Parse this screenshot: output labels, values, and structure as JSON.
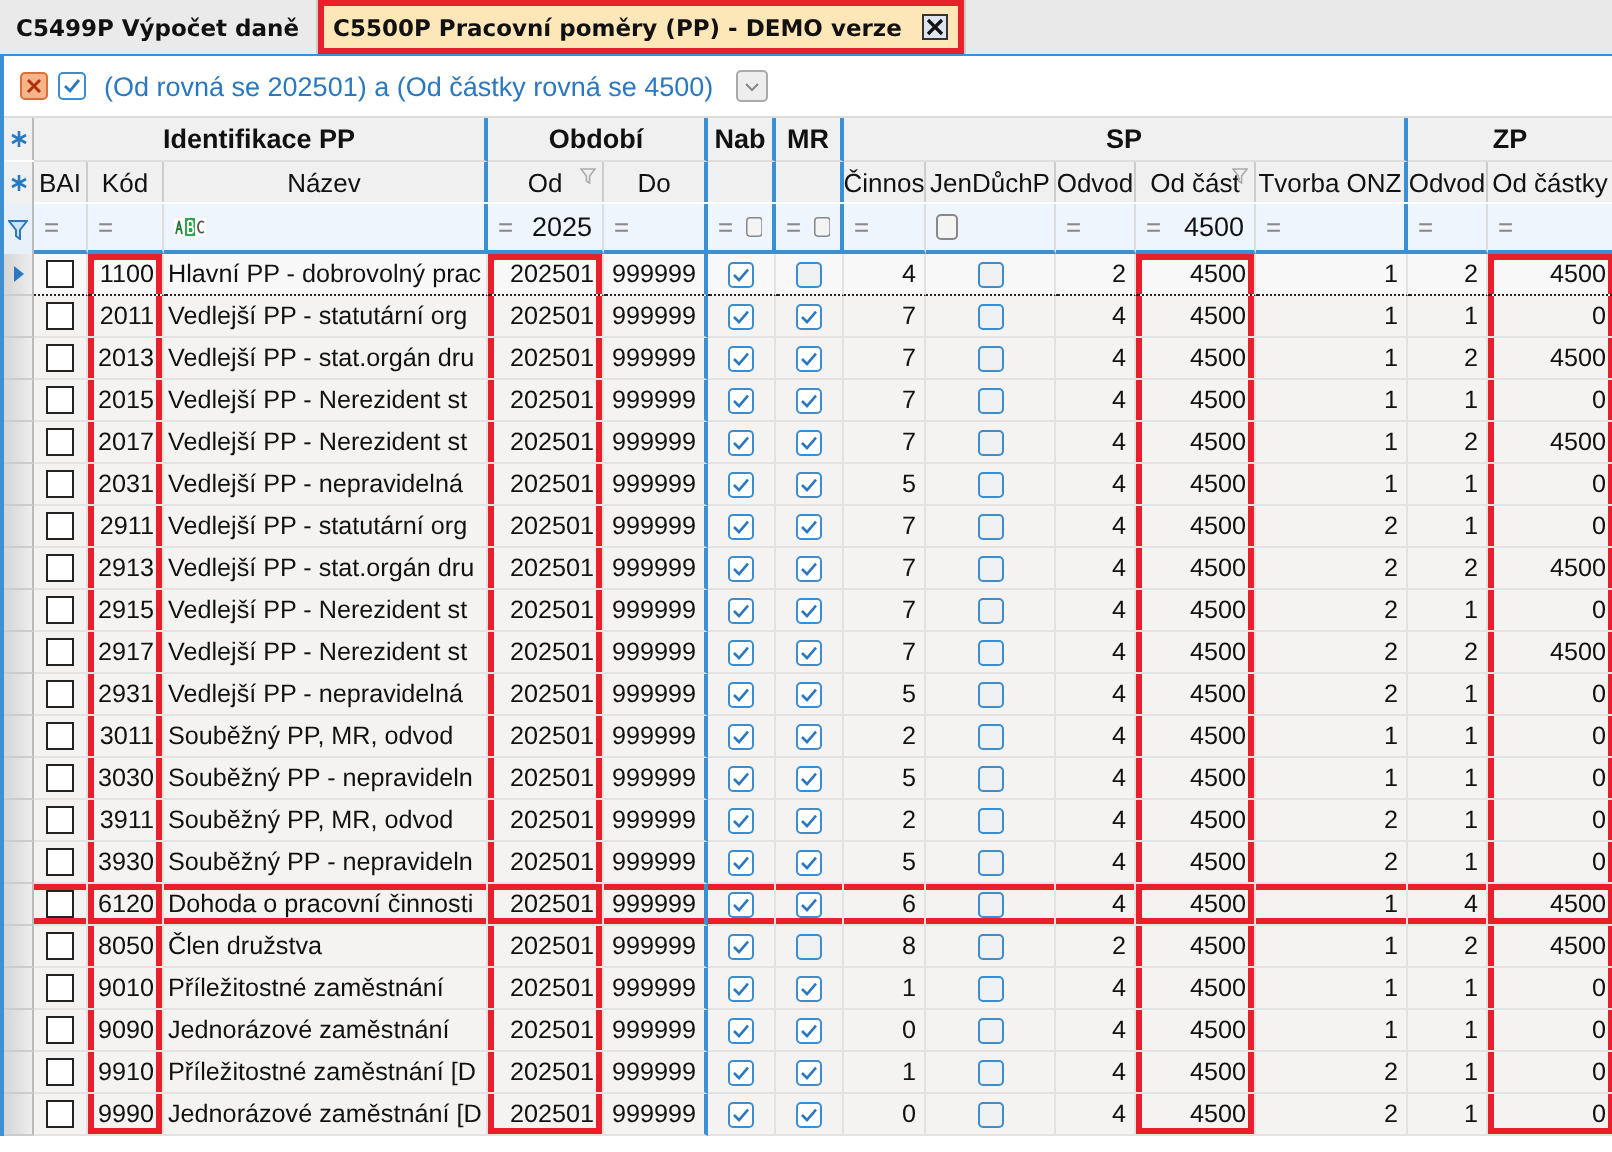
{
  "tabs": [
    {
      "label": "C5499P Výpočet daně",
      "selected": false,
      "closable": false,
      "highlighted": false
    },
    {
      "label": "C5500P Pracovní poměry (PP) - DEMO verze",
      "selected": true,
      "closable": true,
      "highlighted": true
    }
  ],
  "filter_bar": {
    "enabled": true,
    "text": "(Od rovná se 202501) a  (Od částky rovná se 4500)"
  },
  "groups": [
    {
      "label": "Identifikace PP",
      "columns": [
        {
          "label": "BAI",
          "kind": "check",
          "filter": {
            "operator": "=",
            "kind": "none"
          },
          "filtered": false,
          "highlighted": false
        },
        {
          "label": "Kód",
          "kind": "number",
          "filter": {
            "operator": "=",
            "kind": "none"
          },
          "filtered": false,
          "highlighted": true
        },
        {
          "label": "Název",
          "kind": "text",
          "filter": {
            "kind": "abc"
          },
          "filtered": false,
          "highlighted": false
        }
      ]
    },
    {
      "label": "Období",
      "columns": [
        {
          "label": "Od",
          "kind": "number",
          "filter": {
            "operator": "=",
            "kind": "value",
            "value": "2025"
          },
          "filtered": true,
          "highlighted": true
        },
        {
          "label": "Do",
          "kind": "number",
          "filter": {
            "operator": "=",
            "kind": "none"
          },
          "filtered": false,
          "highlighted": false
        }
      ]
    },
    {
      "label": "Nab",
      "columns": [
        {
          "kind": "check",
          "filter": {
            "operator": "=",
            "kind": "check",
            "checked": false
          },
          "filtered": false,
          "highlighted": false
        }
      ]
    },
    {
      "label": "MR",
      "columns": [
        {
          "kind": "check",
          "filter": {
            "operator": "=",
            "kind": "check",
            "checked": false
          },
          "filtered": false,
          "highlighted": false
        }
      ]
    },
    {
      "label": "SP",
      "columns": [
        {
          "label": "Činnos",
          "kind": "number",
          "filter": {
            "operator": "=",
            "kind": "none"
          },
          "filtered": false,
          "highlighted": false
        },
        {
          "label": "JenDůchP",
          "kind": "check",
          "filter": {
            "kind": "check",
            "checked": false
          },
          "filtered": false,
          "highlighted": false
        },
        {
          "label": "Odvod",
          "kind": "number",
          "filter": {
            "operator": "=",
            "kind": "none"
          },
          "filtered": false,
          "highlighted": false
        },
        {
          "label": "Od část",
          "kind": "number",
          "filter": {
            "operator": "=",
            "kind": "value",
            "value": "4500"
          },
          "filtered": true,
          "highlighted": true
        },
        {
          "label": "Tvorba ONZ",
          "kind": "number",
          "filter": {
            "operator": "=",
            "kind": "none"
          },
          "filtered": false,
          "highlighted": false
        }
      ]
    },
    {
      "label": "ZP",
      "columns": [
        {
          "label": "Odvod",
          "kind": "number",
          "filter": {
            "operator": "=",
            "kind": "none"
          },
          "filtered": false,
          "highlighted": false
        },
        {
          "label": "Od částky",
          "kind": "number",
          "filter": {
            "operator": "=",
            "kind": "none"
          },
          "filtered": false,
          "highlighted": true
        }
      ]
    }
  ],
  "rows": [
    {
      "current": true,
      "highlighted": false,
      "cells": [
        false,
        "1100",
        "Hlavní PP - dobrovolný prac",
        "202501",
        "999999",
        true,
        false,
        "4",
        false,
        "2",
        "4500",
        "1",
        "2",
        "4500"
      ]
    },
    {
      "current": false,
      "highlighted": false,
      "cells": [
        false,
        "2011",
        "Vedlejší PP - statutární org",
        "202501",
        "999999",
        true,
        true,
        "7",
        false,
        "4",
        "4500",
        "1",
        "1",
        "0"
      ]
    },
    {
      "current": false,
      "highlighted": false,
      "cells": [
        false,
        "2013",
        "Vedlejší PP - stat.orgán dru",
        "202501",
        "999999",
        true,
        true,
        "7",
        false,
        "4",
        "4500",
        "1",
        "2",
        "4500"
      ]
    },
    {
      "current": false,
      "highlighted": false,
      "cells": [
        false,
        "2015",
        "Vedlejší PP - Nerezident st",
        "202501",
        "999999",
        true,
        true,
        "7",
        false,
        "4",
        "4500",
        "1",
        "1",
        "0"
      ]
    },
    {
      "current": false,
      "highlighted": false,
      "cells": [
        false,
        "2017",
        "Vedlejší PP - Nerezident st",
        "202501",
        "999999",
        true,
        true,
        "7",
        false,
        "4",
        "4500",
        "1",
        "2",
        "4500"
      ]
    },
    {
      "current": false,
      "highlighted": false,
      "cells": [
        false,
        "2031",
        "Vedlejší PP - nepravidelná",
        "202501",
        "999999",
        true,
        true,
        "5",
        false,
        "4",
        "4500",
        "1",
        "1",
        "0"
      ]
    },
    {
      "current": false,
      "highlighted": false,
      "cells": [
        false,
        "2911",
        "Vedlejší PP - statutární org",
        "202501",
        "999999",
        true,
        true,
        "7",
        false,
        "4",
        "4500",
        "2",
        "1",
        "0"
      ]
    },
    {
      "current": false,
      "highlighted": false,
      "cells": [
        false,
        "2913",
        "Vedlejší PP - stat.orgán dru",
        "202501",
        "999999",
        true,
        true,
        "7",
        false,
        "4",
        "4500",
        "2",
        "2",
        "4500"
      ]
    },
    {
      "current": false,
      "highlighted": false,
      "cells": [
        false,
        "2915",
        "Vedlejší PP - Nerezident st",
        "202501",
        "999999",
        true,
        true,
        "7",
        false,
        "4",
        "4500",
        "2",
        "1",
        "0"
      ]
    },
    {
      "current": false,
      "highlighted": false,
      "cells": [
        false,
        "2917",
        "Vedlejší PP - Nerezident st",
        "202501",
        "999999",
        true,
        true,
        "7",
        false,
        "4",
        "4500",
        "2",
        "2",
        "4500"
      ]
    },
    {
      "current": false,
      "highlighted": false,
      "cells": [
        false,
        "2931",
        "Vedlejší PP - nepravidelná",
        "202501",
        "999999",
        true,
        true,
        "5",
        false,
        "4",
        "4500",
        "2",
        "1",
        "0"
      ]
    },
    {
      "current": false,
      "highlighted": false,
      "cells": [
        false,
        "3011",
        "Souběžný PP, MR, odvod",
        "202501",
        "999999",
        true,
        true,
        "2",
        false,
        "4",
        "4500",
        "1",
        "1",
        "0"
      ]
    },
    {
      "current": false,
      "highlighted": false,
      "cells": [
        false,
        "3030",
        "Souběžný PP - nepravideln",
        "202501",
        "999999",
        true,
        true,
        "5",
        false,
        "4",
        "4500",
        "1",
        "1",
        "0"
      ]
    },
    {
      "current": false,
      "highlighted": false,
      "cells": [
        false,
        "3911",
        "Souběžný PP, MR, odvod",
        "202501",
        "999999",
        true,
        true,
        "2",
        false,
        "4",
        "4500",
        "2",
        "1",
        "0"
      ]
    },
    {
      "current": false,
      "highlighted": false,
      "cells": [
        false,
        "3930",
        "Souběžný PP - nepravideln",
        "202501",
        "999999",
        true,
        true,
        "5",
        false,
        "4",
        "4500",
        "2",
        "1",
        "0"
      ]
    },
    {
      "current": false,
      "highlighted": true,
      "cells": [
        false,
        "6120",
        "Dohoda o pracovní činnosti",
        "202501",
        "999999",
        true,
        true,
        "6",
        false,
        "4",
        "4500",
        "1",
        "4",
        "4500"
      ]
    },
    {
      "current": false,
      "highlighted": false,
      "cells": [
        false,
        "8050",
        "Člen družstva",
        "202501",
        "999999",
        true,
        false,
        "8",
        false,
        "2",
        "4500",
        "1",
        "2",
        "4500"
      ]
    },
    {
      "current": false,
      "highlighted": false,
      "cells": [
        false,
        "9010",
        "Příležitostné zaměstnání",
        "202501",
        "999999",
        true,
        true,
        "1",
        false,
        "4",
        "4500",
        "1",
        "1",
        "0"
      ]
    },
    {
      "current": false,
      "highlighted": false,
      "cells": [
        false,
        "9090",
        "Jednorázové zaměstnání",
        "202501",
        "999999",
        true,
        true,
        "0",
        false,
        "4",
        "4500",
        "1",
        "1",
        "0"
      ]
    },
    {
      "current": false,
      "highlighted": false,
      "cells": [
        false,
        "9910",
        "Příležitostné zaměstnání [D",
        "202501",
        "999999",
        true,
        true,
        "1",
        false,
        "4",
        "4500",
        "2",
        "1",
        "0"
      ]
    },
    {
      "current": false,
      "highlighted": false,
      "cells": [
        false,
        "9990",
        "Jednorázové zaměstnání [D",
        "202501",
        "999999",
        true,
        true,
        "0",
        false,
        "4",
        "4500",
        "2",
        "1",
        "0"
      ]
    }
  ]
}
